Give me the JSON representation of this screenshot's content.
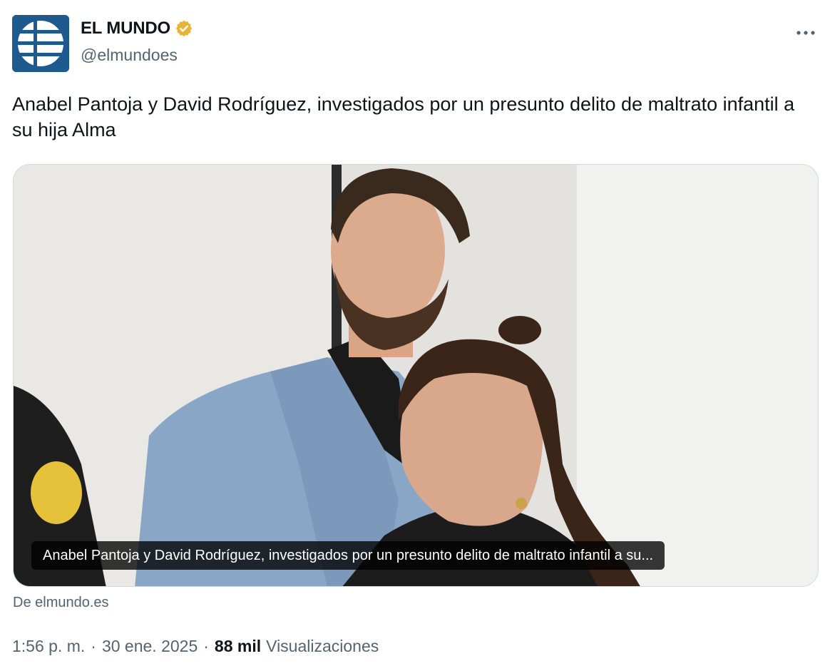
{
  "author": {
    "name": "EL MUNDO",
    "handle": "@elmundoes",
    "verified_badge_color": "#e8b339",
    "avatar_bg": "#1f5a8f"
  },
  "tweet": {
    "text": "Anabel Pantoja y David Rodríguez, investigados por un presunto delito de maltrato infantil a su hija Alma"
  },
  "media": {
    "caption": "Anabel Pantoja y David Rodríguez, investigados por un presunto delito de maltrato infantil a su...",
    "source": "De elmundo.es"
  },
  "meta": {
    "time": "1:56 p. m.",
    "separator": "·",
    "date": "30 ene. 2025",
    "views_count": "88 mil",
    "views_label": "Visualizaciones"
  },
  "icons": {
    "more": "more-horizontal-icon",
    "verified": "verified-badge-icon"
  },
  "colors": {
    "text_primary": "#0f1419",
    "text_secondary": "#536471",
    "border": "#cfd9de"
  }
}
